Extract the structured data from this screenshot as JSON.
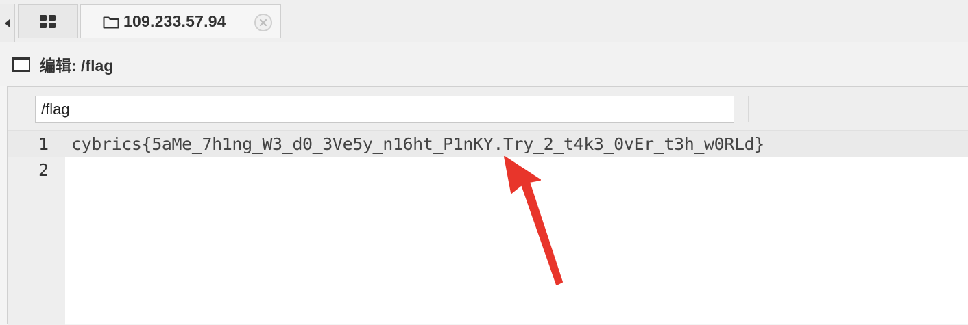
{
  "tabs": {
    "host_label": "109.233.57.94"
  },
  "editor": {
    "title": "编辑: /flag",
    "path_value": "/flag",
    "lines": [
      {
        "number": "1",
        "text": "cybrics{5aMe_7h1ng_W3_d0_3Ve5y_n16ht_P1nKY.Try_2_t4k3_0vEr_t3h_w0RLd}"
      },
      {
        "number": "2",
        "text": ""
      }
    ]
  },
  "annotation": {
    "arrow_color": "#e8352b"
  },
  "icons": [
    "chevron-left-icon",
    "grid-icon",
    "folder-icon",
    "close-icon",
    "window-icon"
  ]
}
